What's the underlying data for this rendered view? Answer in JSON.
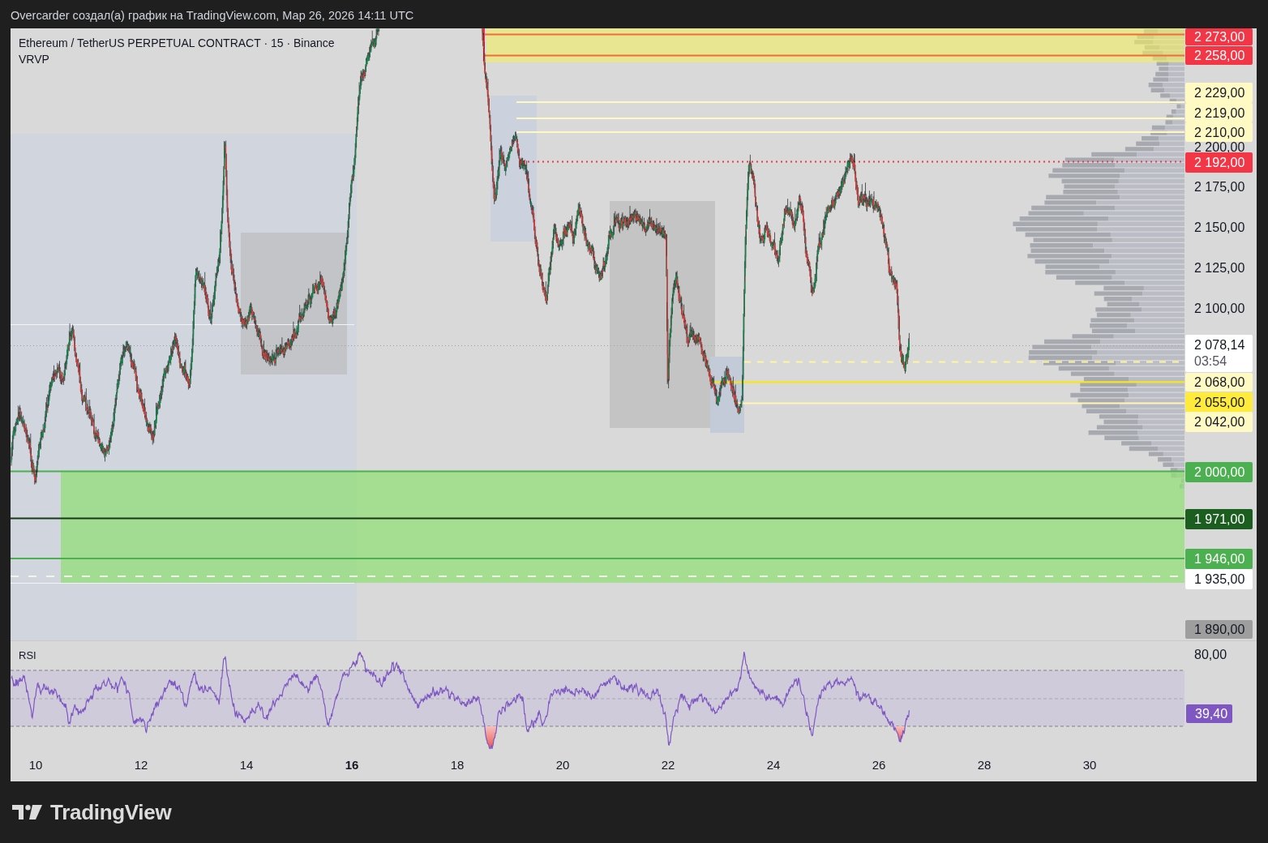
{
  "header": {
    "text": "Overcarder создал(а) график на TradingView.com, Мар 26, 2026 14:11 UTC"
  },
  "chart": {
    "legend": {
      "symbol": "Ethereum / TetherUS PERPETUAL CONTRACT · 15 · Binance",
      "indicator": "VRVP"
    },
    "price_axis": {
      "ticks": [
        "2 200,00",
        "2 175,00",
        "2 150,00",
        "2 125,00",
        "2 100,00"
      ],
      "tags": [
        {
          "label": "2 273,00",
          "color": "#f23645"
        },
        {
          "label": "2 258,00",
          "color": "#f23645"
        },
        {
          "label": "2 229,00",
          "color": "#fff9c4"
        },
        {
          "label": "2 219,00",
          "color": "#fff9c4"
        },
        {
          "label": "2 210,00",
          "color": "#fff9c4"
        },
        {
          "label": "2 192,00",
          "color": "#f23645"
        },
        {
          "label": "2 078,14",
          "countdown": "03:54",
          "color": "#ffffff"
        },
        {
          "label": "2 068,00",
          "color": "#fff9c4"
        },
        {
          "label": "2 055,00",
          "color": "#ffeb3b"
        },
        {
          "label": "2 042,00",
          "color": "#fff9c4"
        },
        {
          "label": "2 000,00",
          "color": "#4caf50"
        },
        {
          "label": "1 971,00",
          "color": "#1b5e20"
        },
        {
          "label": "1 946,00",
          "color": "#4caf50"
        },
        {
          "label": "1 935,00",
          "color": "#ffffff"
        },
        {
          "label": "1 890,00",
          "color": "#9e9e9e"
        }
      ]
    },
    "rsi": {
      "label": "RSI",
      "tick": "80,00",
      "value_tag": {
        "label": "39,40",
        "color": "#7e57c2"
      }
    },
    "time_axis": {
      "labels": [
        {
          "label": "10",
          "bold": false
        },
        {
          "label": "12",
          "bold": false
        },
        {
          "label": "14",
          "bold": false
        },
        {
          "label": "16",
          "bold": true
        },
        {
          "label": "18",
          "bold": false
        },
        {
          "label": "20",
          "bold": false
        },
        {
          "label": "22",
          "bold": false
        },
        {
          "label": "24",
          "bold": false
        },
        {
          "label": "26",
          "bold": false
        },
        {
          "label": "28",
          "bold": false
        },
        {
          "label": "30",
          "bold": false
        }
      ]
    }
  },
  "footer": {
    "logo_text": "TradingView"
  }
}
